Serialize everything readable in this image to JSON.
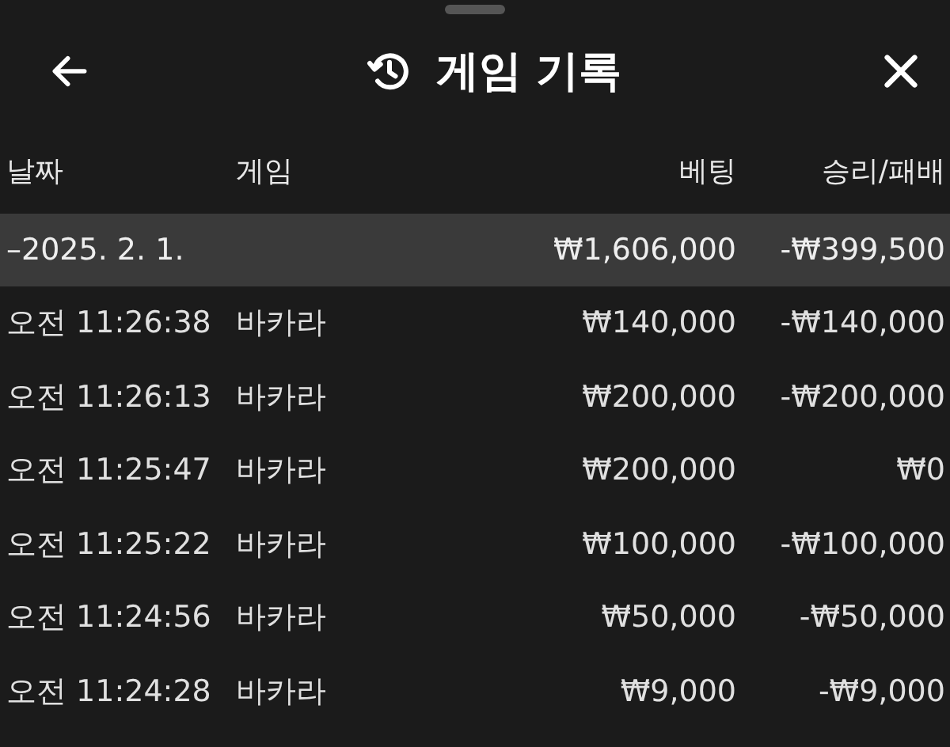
{
  "header": {
    "title": "게임 기록"
  },
  "table": {
    "columns": [
      "날짜",
      "게임",
      "베팅",
      "승리/패배"
    ],
    "group": {
      "date": "–2025. 2. 1.",
      "bet": "₩1,606,000",
      "result": "-₩399,500"
    },
    "rows": [
      {
        "time": "오전 11:26:38",
        "game": "바카라",
        "bet": "₩140,000",
        "result": "-₩140,000"
      },
      {
        "time": "오전 11:26:13",
        "game": "바카라",
        "bet": "₩200,000",
        "result": "-₩200,000"
      },
      {
        "time": "오전 11:25:47",
        "game": "바카라",
        "bet": "₩200,000",
        "result": "₩0"
      },
      {
        "time": "오전 11:25:22",
        "game": "바카라",
        "bet": "₩100,000",
        "result": "-₩100,000"
      },
      {
        "time": "오전 11:24:56",
        "game": "바카라",
        "bet": "₩50,000",
        "result": "-₩50,000"
      },
      {
        "time": "오전 11:24:28",
        "game": "바카라",
        "bet": "₩9,000",
        "result": "-₩9,000"
      }
    ]
  }
}
